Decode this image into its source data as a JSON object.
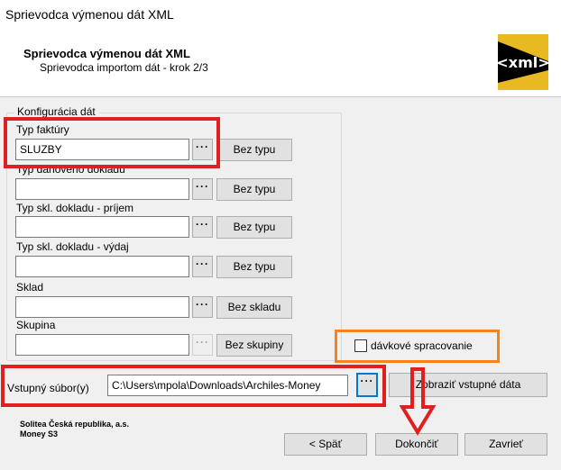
{
  "window": {
    "title": "Sprievodca výmenou dát XML"
  },
  "header": {
    "title": "Sprievodca výmenou dát XML",
    "subtitle": "Sprievodca importom dát - krok 2/3",
    "logo_text": "<xml>"
  },
  "group": {
    "legend": "Konfigurácia dát"
  },
  "fields": {
    "typ_faktury": {
      "label": "Typ faktúry",
      "value": "SLUZBY",
      "button": "Bez typu"
    },
    "typ_danoveho": {
      "label": "Typ daňového dokladu",
      "value": "",
      "button": "Bez typu"
    },
    "typ_prijem": {
      "label": "Typ skl. dokladu - príjem",
      "value": "",
      "button": "Bez typu"
    },
    "typ_vydaj": {
      "label": "Typ skl. dokladu - výdaj",
      "value": "",
      "button": "Bez typu"
    },
    "sklad": {
      "label": "Sklad",
      "value": "",
      "button": "Bez skladu"
    },
    "skupina": {
      "label": "Skupina",
      "value": "",
      "button": "Bez skupiny"
    }
  },
  "dots_label": "···",
  "batch": {
    "label": "dávkové spracovanie",
    "checked": false
  },
  "input_file": {
    "label": "Vstupný súbor(y)",
    "value": "C:\\Users\\mpola\\Downloads\\Archiles-Money",
    "show_button": "Zobraziť vstupné dáta"
  },
  "footer": {
    "company": "Solitea Česká republika, a.s.",
    "product": "Money S3",
    "back": "< Späť",
    "finish": "Dokončiť",
    "close": "Zavrieť"
  },
  "annotation_colors": {
    "red": "#e02020",
    "orange": "#f5821f",
    "focus": "#0078d7"
  }
}
